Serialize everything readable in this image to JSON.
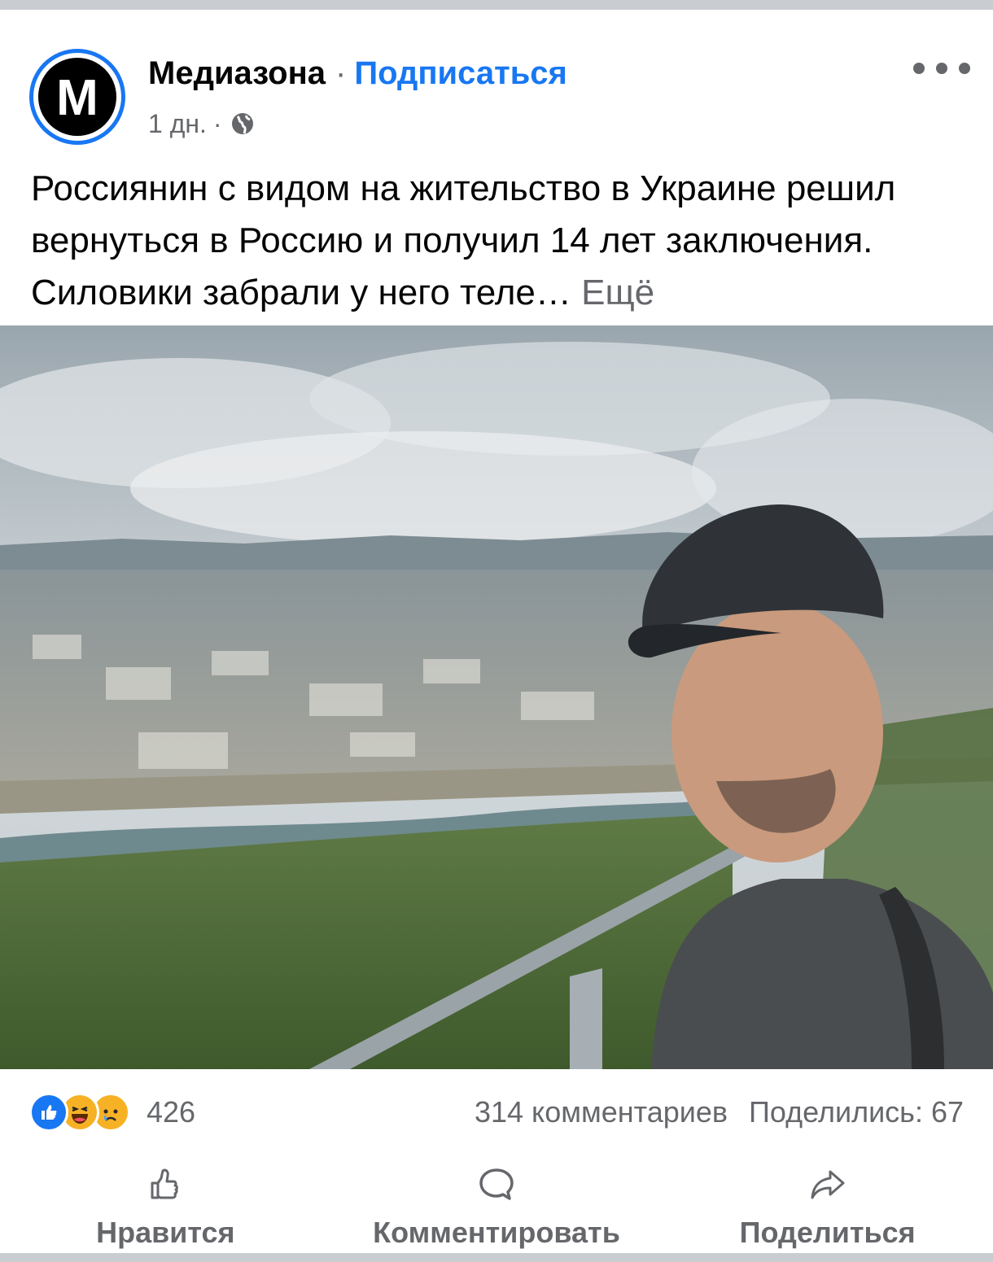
{
  "header": {
    "avatar_letter": "M",
    "page_name": "Медиазона",
    "separator": "·",
    "follow_label": "Подписаться",
    "time": "1 дн.",
    "meta_separator": "·",
    "privacy_icon": "globe-icon",
    "more_icon": "more-dots-icon"
  },
  "post": {
    "text": "Россиянин с видом на жительство в Украине решил вернуться в Россию и получил 14 лет заключения. Силовики забрали у него теле…",
    "see_more": "Ещё"
  },
  "stats": {
    "reactions": [
      "like-reaction-icon",
      "haha-reaction-icon",
      "sad-reaction-icon"
    ],
    "reactions_count": "426",
    "comments": "314 комментариев",
    "shares": "Поделились: 67"
  },
  "actions": {
    "like": "Нравится",
    "comment": "Комментировать",
    "share": "Поделиться"
  },
  "colors": {
    "brand_blue": "#1877f2",
    "secondary_text": "#65676b",
    "primary_text": "#050505"
  }
}
